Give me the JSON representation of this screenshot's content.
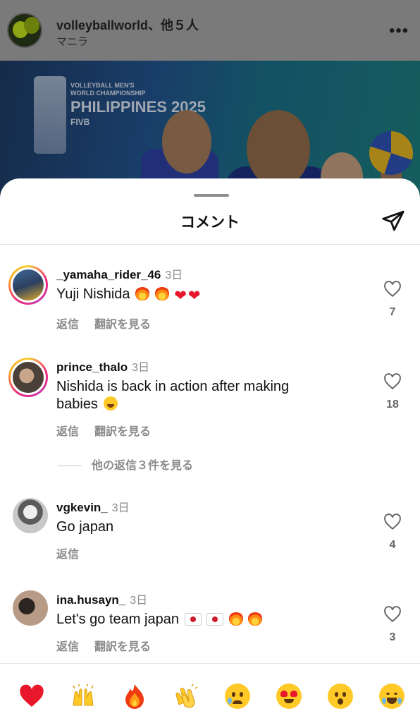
{
  "post": {
    "username": "volleyballworld、他５人",
    "location": "マニラ",
    "more_icon": "more-horizontal-icon",
    "banner": {
      "line1": "VOLLEYBALL MEN'S WORLD CHAMPIONSHIP",
      "line2": "PHILIPPINES 2025",
      "line3": "FIVB"
    }
  },
  "sheet": {
    "title": "コメント",
    "share_icon": "send-icon"
  },
  "comments": [
    {
      "username": "_yamaha_rider_46",
      "age": "3日",
      "text": "Yuji Nishida",
      "emojis": [
        "fire",
        "fire",
        "red-heart",
        "red-heart"
      ],
      "reply_label": "返信",
      "translate_label": "翻訳を見る",
      "likes": "7",
      "has_story": true
    },
    {
      "username": "prince_thalo",
      "age": "3日",
      "text_line1": "Nishida is back in action after making",
      "text_line2": "babies",
      "emojis": [
        "face-with-tears-of-joy"
      ],
      "reply_label": "返信",
      "translate_label": "翻訳を見る",
      "likes": "18",
      "has_story": true,
      "more_replies": "他の返信３件を見る"
    },
    {
      "username": "vgkevin_",
      "age": "3日",
      "text": "Go japan",
      "reply_label": "返信",
      "likes": "4",
      "has_story": false
    },
    {
      "username": "ina.husayn_",
      "age": "3日",
      "text": "Let's go team japan",
      "emojis": [
        "flag-japan",
        "flag-japan",
        "fire",
        "fire"
      ],
      "reply_label": "返信",
      "translate_label": "翻訳を見る",
      "likes": "3",
      "has_story": false
    }
  ],
  "reactions": [
    "red-heart",
    "raising-hands",
    "fire",
    "clapping-hands",
    "crying-face",
    "heart-eyes",
    "surprised-face",
    "face-with-tears-of-joy"
  ],
  "colors": {
    "heart": "#e8172b",
    "secondary_text": "#8a8a8a",
    "sheet_bg": "#ffffff"
  }
}
